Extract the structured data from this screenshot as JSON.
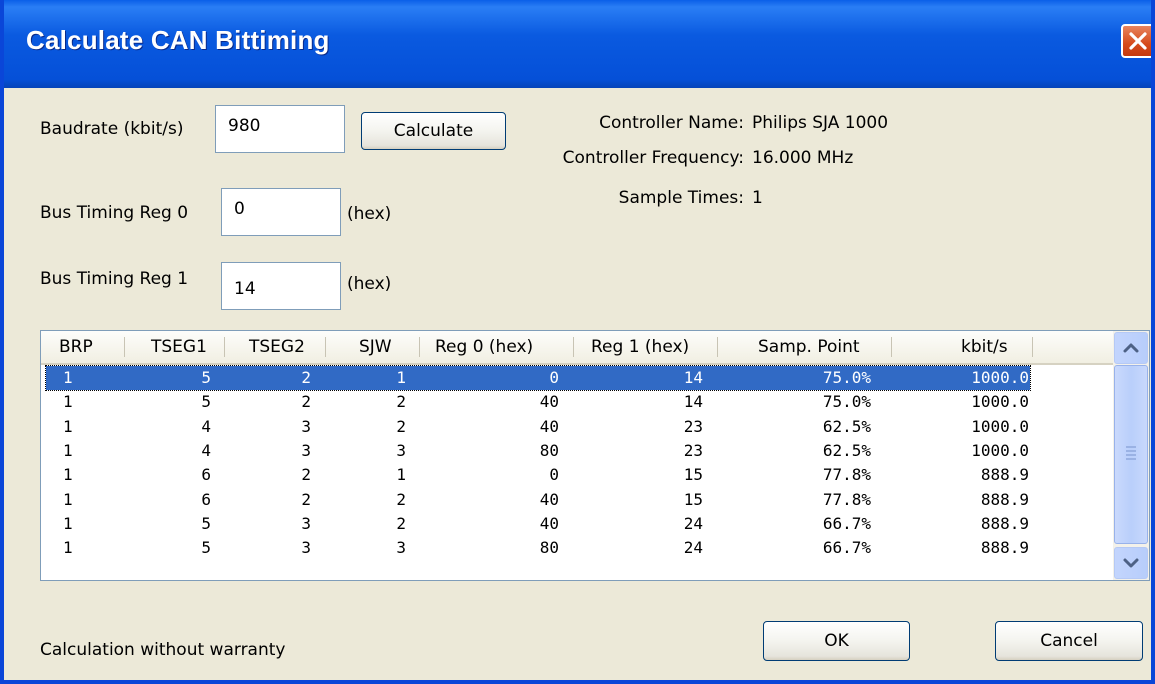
{
  "window": {
    "title": "Calculate CAN Bittiming"
  },
  "form": {
    "baudrate_label": "Baudrate (kbit/s)",
    "baudrate_value": "980",
    "calculate_label": "Calculate",
    "btr0_label": "Bus Timing Reg 0",
    "btr0_value": "0",
    "btr0_unit": "(hex)",
    "btr1_label": "Bus Timing Reg 1",
    "btr1_value": "14",
    "btr1_unit": "(hex)"
  },
  "info": {
    "controller_name_label": "Controller Name:",
    "controller_name_value": "Philips SJA 1000",
    "controller_freq_label": "Controller Frequency:",
    "controller_freq_value": "16.000 MHz",
    "sample_times_label": "Sample Times:",
    "sample_times_value": "1"
  },
  "table": {
    "columns": [
      "BRP",
      "TSEG1",
      "TSEG2",
      "SJW",
      "Reg 0 (hex)",
      "Reg 1 (hex)",
      "Samp. Point",
      "kbit/s"
    ],
    "selected_row": 0,
    "rows": [
      [
        "1",
        "5",
        "2",
        "1",
        "0",
        "14",
        "75.0%",
        "1000.0"
      ],
      [
        "1",
        "5",
        "2",
        "2",
        "40",
        "14",
        "75.0%",
        "1000.0"
      ],
      [
        "1",
        "4",
        "3",
        "2",
        "40",
        "23",
        "62.5%",
        "1000.0"
      ],
      [
        "1",
        "4",
        "3",
        "3",
        "80",
        "23",
        "62.5%",
        "1000.0"
      ],
      [
        "1",
        "6",
        "2",
        "1",
        "0",
        "15",
        "77.8%",
        "888.9"
      ],
      [
        "1",
        "6",
        "2",
        "2",
        "40",
        "15",
        "77.8%",
        "888.9"
      ],
      [
        "1",
        "5",
        "3",
        "2",
        "40",
        "24",
        "66.7%",
        "888.9"
      ],
      [
        "1",
        "5",
        "3",
        "3",
        "80",
        "24",
        "66.7%",
        "888.9"
      ]
    ]
  },
  "footer": {
    "disclaimer": "Calculation without warranty",
    "ok_label": "OK",
    "cancel_label": "Cancel"
  }
}
